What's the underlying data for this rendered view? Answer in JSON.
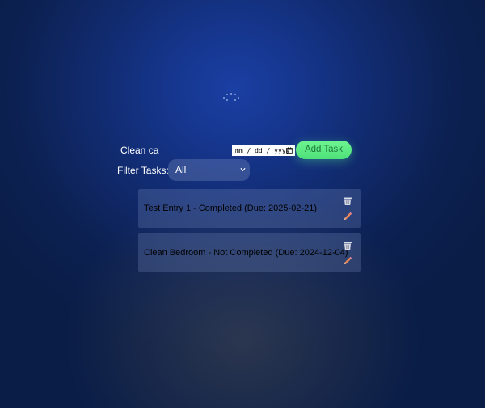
{
  "form": {
    "task_value": "Clean ca",
    "date_placeholder": "mm / dd / yyyy",
    "add_button_label": "Add Task"
  },
  "filter": {
    "label": "Filter Tasks:",
    "selected": "All"
  },
  "tasks": [
    {
      "text": "Test Entry 1 - Completed (Due: 2025-02-21)"
    },
    {
      "text": "Clean Bedroom - Not Completed (Due: 2024-12-04)"
    }
  ],
  "icons": {
    "delete": "trash-icon",
    "edit": "pencil-icon",
    "calendar": "calendar-icon",
    "dropdown": "chevron-down-icon"
  },
  "colors": {
    "background": "#112b6f",
    "add_button": "#5ceb85",
    "add_button_text": "#1f7a3c",
    "trash": "#d9dbe6",
    "pencil": "#e8855a"
  }
}
